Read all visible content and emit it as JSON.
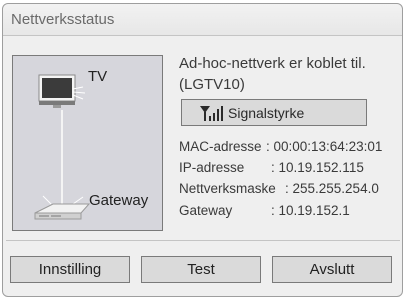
{
  "dialog": {
    "title": "Nettverksstatus"
  },
  "diagram": {
    "tv_label": "TV",
    "gateway_label": "Gateway"
  },
  "status": {
    "connection_text": "Ad-hoc-nettverk er koblet til.",
    "network_name": "(LGTV10)",
    "signal_label": "Signalstyrke",
    "signal_icon": "signal-strength-icon"
  },
  "details": [
    {
      "label": "MAC-adresse",
      "value": ": 00:00:13:64:23:01"
    },
    {
      "label": "IP-adresse",
      "value": ": 10.19.152.115"
    },
    {
      "label": "Nettverksmaske",
      "value": ": 255.255.254.0"
    },
    {
      "label": "Gateway",
      "value": ": 10.19.152.1"
    }
  ],
  "buttons": {
    "settings": "Innstilling",
    "test": "Test",
    "exit": "Avslutt"
  },
  "colors": {
    "panel": "#efefef",
    "diagram_bg": "#d6d6dc",
    "button_bg": "#dadada",
    "border": "#7a7a7a"
  }
}
